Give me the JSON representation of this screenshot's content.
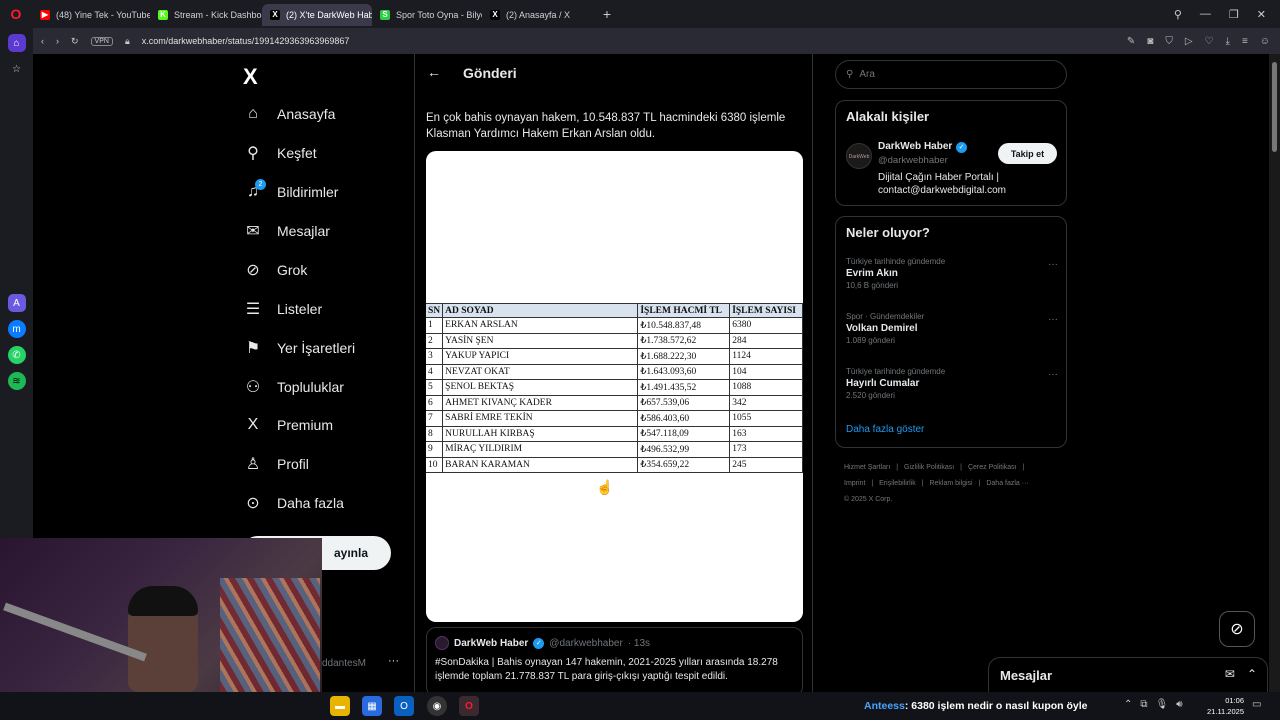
{
  "browser": {
    "tabs": [
      {
        "label": "(48) Yine Tek - YouTube",
        "fav": "▶",
        "color": "#ff0000",
        "active": false
      },
      {
        "label": "Stream - Kick Dashboard",
        "fav": "K",
        "color": "#53fc18",
        "active": false
      },
      {
        "label": "(2) X'te DarkWeb Haber: \"",
        "fav": "X",
        "color": "#000000",
        "active": true
      },
      {
        "label": "Spor Toto Oyna - Bilyoner",
        "fav": "S",
        "color": "#2ecc40",
        "active": false
      },
      {
        "label": "(2) Anasayfa / X",
        "fav": "X",
        "color": "#000000",
        "active": false
      }
    ],
    "vpn": "VPN",
    "url": "x.com/darkwebhaber/status/1991429363963969867"
  },
  "nav": {
    "items": [
      {
        "label": "Anasayfa",
        "icon": "home-icon",
        "glyph": "⌂"
      },
      {
        "label": "Keşfet",
        "icon": "search-icon",
        "glyph": "⚲"
      },
      {
        "label": "Bildirimler",
        "icon": "bell-icon",
        "glyph": "🔔"
      },
      {
        "label": "Mesajlar",
        "icon": "mail-icon",
        "glyph": "✉"
      },
      {
        "label": "Grok",
        "icon": "grok-icon",
        "glyph": "⊘"
      },
      {
        "label": "Listeler",
        "icon": "list-icon",
        "glyph": "☰"
      },
      {
        "label": "Yer İşaretleri",
        "icon": "bookmark-icon",
        "glyph": "⚑"
      },
      {
        "label": "Topluluklar",
        "icon": "community-icon",
        "glyph": "👥"
      },
      {
        "label": "Premium",
        "icon": "x-premium-icon",
        "glyph": "X"
      },
      {
        "label": "Profil",
        "icon": "person-icon",
        "glyph": "👤"
      },
      {
        "label": "Daha fazla",
        "icon": "more-circle-icon",
        "glyph": "⋯"
      }
    ],
    "notif_count": "2",
    "post_label": "ayınla"
  },
  "post": {
    "header_title": "Gönderi",
    "text": "En çok bahis oynayan hakem, 10.548.837 TL hacmindeki 6380 işlemle Klasman Yardımcı Hakem Erkan Arslan oldu.",
    "table": {
      "headers": [
        "SN",
        "AD SOYAD",
        "İŞLEM HACMİ TL",
        "İŞLEM SAYISI"
      ],
      "rows": [
        [
          "1",
          "ERKAN ARSLAN",
          "₺10.548.837,48",
          "6380"
        ],
        [
          "2",
          "YASİN ŞEN",
          "₺1.738.572,62",
          "284"
        ],
        [
          "3",
          "YAKUP YAPICI",
          "₺1.688.222,30",
          "1124"
        ],
        [
          "4",
          "NEVZAT OKAT",
          "₺1.643.093,60",
          "104"
        ],
        [
          "5",
          "ŞENOL BEKTAŞ",
          "₺1.491.435,52",
          "1088"
        ],
        [
          "6",
          "AHMET KIVANÇ KADER",
          "₺657.539,06",
          "342"
        ],
        [
          "7",
          "SABRİ EMRE TEKİN",
          "₺586.403,60",
          "1055"
        ],
        [
          "8",
          "NURULLAH KIRBAŞ",
          "₺547.118,09",
          "163"
        ],
        [
          "9",
          "MİRAÇ YILDIRIM",
          "₺496.532,99",
          "173"
        ],
        [
          "10",
          "BARAN KARAMAN",
          "₺354.659,22",
          "245"
        ]
      ]
    },
    "quote": {
      "name": "DarkWeb Haber",
      "handle": "@darkwebhaber",
      "time": "· 13s",
      "text": "#SonDakika | Bahis oynayan 147 hakemin, 2021-2025 yılları arasında 18.278 işlemde toplam 21.778.837 TL para giriş-çıkışı yaptığı tespit edildi."
    }
  },
  "right": {
    "search_placeholder": "Ara",
    "related_title": "Alakalı kişiler",
    "related": {
      "avatar_text": "DarkWeb",
      "name": "DarkWeb Haber",
      "handle": "@darkwebhaber",
      "follow_label": "Takip et",
      "bio": "Dijital Çağın Haber Portalı | contact@darkwebdigital.com"
    },
    "trends_title": "Neler oluyor?",
    "trends": [
      {
        "meta": "Türkiye tarihinde gündemde",
        "name": "Evrim Akın",
        "count": "10,6 B gönderi"
      },
      {
        "meta": "Spor · Gündemdekiler",
        "name": "Volkan Demirel",
        "count": "1.089 gönderi"
      },
      {
        "meta": "Türkiye tarihinde gündemde",
        "name": "Hayırlı Cumalar",
        "count": "2.520 gönderi"
      }
    ],
    "show_more": "Daha fazla göster",
    "footer": [
      "Hizmet Şartları",
      "|",
      "Gizlilik Politikası",
      "|",
      "Çerez Politikası",
      "|",
      "Imprint",
      "|",
      "Erişilebilirlik",
      "|",
      "Reklam bilgisi",
      "|",
      "Daha fazla ···",
      "© 2025 X Corp."
    ]
  },
  "messages": {
    "title": "Mesajlar"
  },
  "stream": {
    "user_fragment": "ddantesM",
    "more": "···"
  },
  "taskbar": {
    "ticker_user": "Anteess",
    "ticker_text": ": 6380 işlem nedir o nasıl kupon öyle",
    "time": "01:06",
    "date": "21.11.2025"
  }
}
